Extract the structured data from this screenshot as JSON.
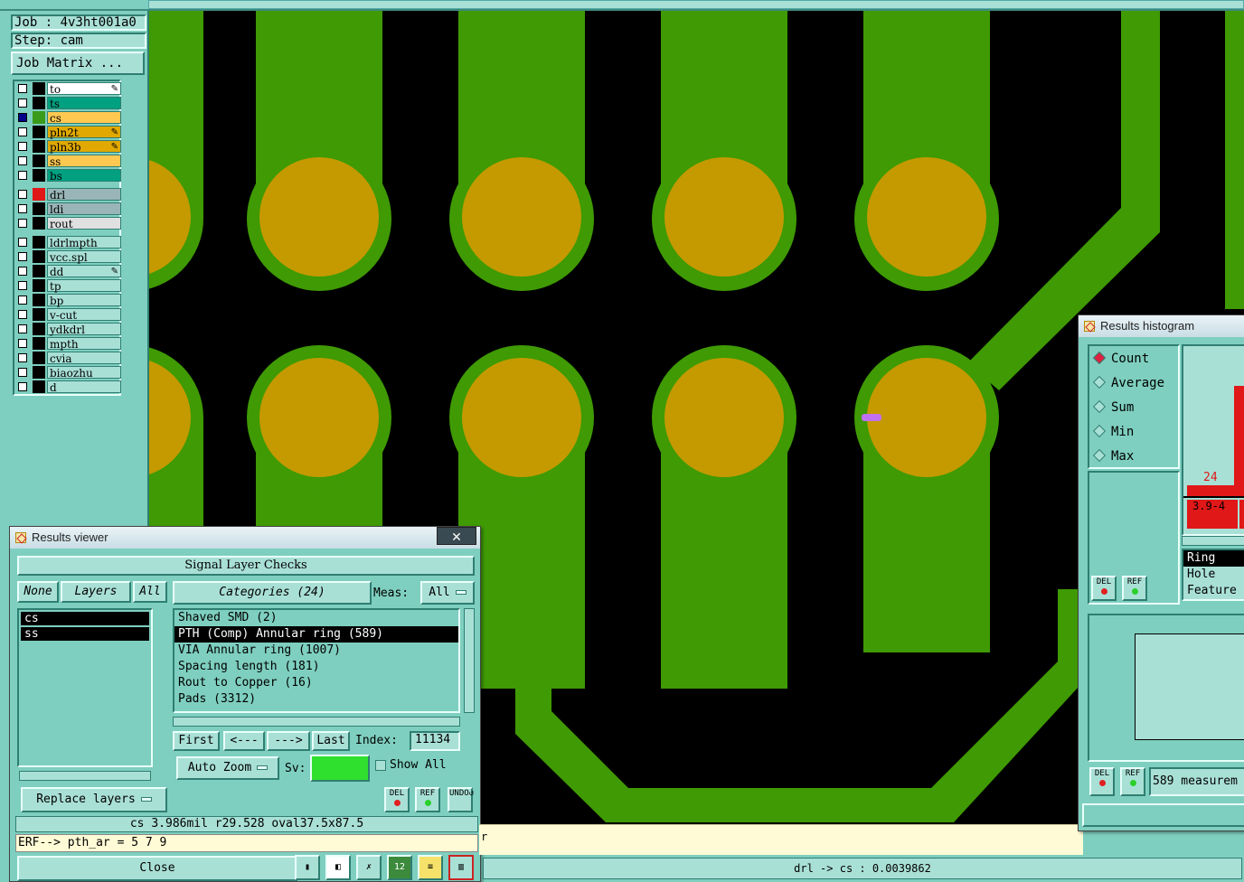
{
  "job": {
    "job_label": "Job : 4v3ht001a0",
    "step_label": "Step: cam",
    "matrix_button": "Job Matrix ..."
  },
  "layers": [
    {
      "name": "to",
      "color": "#ffffff",
      "checked": false,
      "swatch": "#000000",
      "edit": true
    },
    {
      "name": "ts",
      "color": "#00a080",
      "checked": false,
      "swatch": "#000000",
      "edit": false
    },
    {
      "name": "cs",
      "color": "#ffc850",
      "checked": true,
      "swatch": "#3a9a1a",
      "edit": false
    },
    {
      "name": "pln2t",
      "color": "#e0a800",
      "checked": false,
      "swatch": "#000000",
      "edit": true
    },
    {
      "name": "pln3b",
      "color": "#e0a800",
      "checked": false,
      "swatch": "#000000",
      "edit": true
    },
    {
      "name": "ss",
      "color": "#ffc850",
      "checked": false,
      "swatch": "#000000",
      "edit": false
    },
    {
      "name": "bs",
      "color": "#00a080",
      "checked": false,
      "swatch": "#000000",
      "edit": false
    },
    {
      "sep": true
    },
    {
      "name": "drl",
      "color": "#9ab5b8",
      "checked": false,
      "swatch": "#e01818",
      "edit": false
    },
    {
      "name": "ldi",
      "color": "#9ab5b8",
      "checked": false,
      "swatch": "#000000",
      "edit": false
    },
    {
      "name": "rout",
      "color": "#e0e0e0",
      "checked": false,
      "swatch": "#000000",
      "edit": false
    },
    {
      "sep": true
    },
    {
      "name": "ldrlmpth",
      "color": "#a9e0d6",
      "checked": false,
      "swatch": "#000000",
      "edit": false
    },
    {
      "name": "vcc.spl",
      "color": "#a9e0d6",
      "checked": false,
      "swatch": "#000000",
      "edit": false
    },
    {
      "name": "dd",
      "color": "#a9e0d6",
      "checked": false,
      "swatch": "#000000",
      "edit": true
    },
    {
      "name": "tp",
      "color": "#a9e0d6",
      "checked": false,
      "swatch": "#000000",
      "edit": false
    },
    {
      "name": "bp",
      "color": "#a9e0d6",
      "checked": false,
      "swatch": "#000000",
      "edit": false
    },
    {
      "name": "v-cut",
      "color": "#a9e0d6",
      "checked": false,
      "swatch": "#000000",
      "edit": false
    },
    {
      "name": "ydkdrl",
      "color": "#a9e0d6",
      "checked": false,
      "swatch": "#000000",
      "edit": false
    },
    {
      "name": "mpth",
      "color": "#a9e0d6",
      "checked": false,
      "swatch": "#000000",
      "edit": false
    },
    {
      "name": "cvia",
      "color": "#a9e0d6",
      "checked": false,
      "swatch": "#000000",
      "edit": false
    },
    {
      "name": "biaozhu",
      "color": "#a9e0d6",
      "checked": false,
      "swatch": "#000000",
      "edit": false
    },
    {
      "name": "d",
      "color": "#a9e0d6",
      "checked": false,
      "swatch": "#000000",
      "edit": false
    }
  ],
  "results_viewer": {
    "title": "Results viewer",
    "close_glyph": "✕",
    "header": "Signal Layer Checks",
    "none_btn": "None",
    "layers_btn": "Layers",
    "all_btn": "All",
    "categories_btn": "Categories (24)",
    "meas_label": "Meas:",
    "meas_value": "All",
    "layer_items": [
      "cs",
      "ss"
    ],
    "categories": [
      "Shaved SMD (2)",
      "PTH (Comp) Annular ring (589)",
      "VIA Annular ring (1007)",
      "Spacing length (181)",
      "Rout to Copper (16)",
      "Pads (3312)"
    ],
    "selected_category": 1,
    "first_btn": "First",
    "prev_btn": "<---",
    "next_btn": "--->",
    "last_btn": "Last",
    "index_label": "Index:",
    "index_value": "11134",
    "replace_btn": "Replace layers",
    "autozoom_btn": "Auto Zoom",
    "sv_label": "Sv:",
    "show_all_label": "Show All",
    "del_label": "DEL",
    "ref_label": "REF",
    "undo_label": "UNDO",
    "measure_line": "cs 3.986mil  r29.528  oval37.5x87.5",
    "erf_line": "ERF--> pth_ar = 5 7 9",
    "close_btn": "Close"
  },
  "histogram": {
    "title": "Results histogram",
    "options": [
      "Count",
      "Average",
      "Sum",
      "Min",
      "Max"
    ],
    "selected": 0,
    "bar_value": "24",
    "bar_range": "3.9-4",
    "legend_items": [
      "Ring",
      "Hole",
      "Feature"
    ],
    "del_label": "DEL",
    "ref_label": "REF",
    "measures_text": "589 measurem"
  },
  "status": {
    "message": "drl -> cs : 0.0039862",
    "cream_text": "r"
  },
  "colors": {
    "copper": "#3f9a04",
    "pad": "#c49a00",
    "bg": "#000000",
    "panel": "#7ecfbf"
  }
}
